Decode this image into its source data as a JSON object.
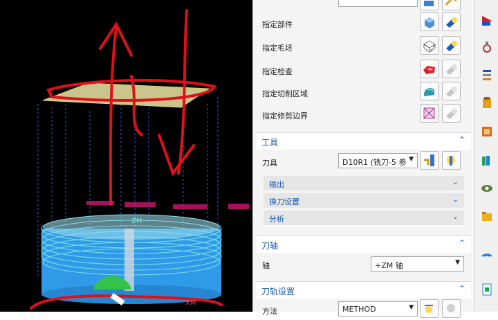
{
  "panel": {
    "geometry_rows": [
      {
        "label": "指定部件",
        "icon1": "part-select-icon",
        "icon2": "flashlight-icon"
      },
      {
        "label": "指定毛坯",
        "icon1": "blank-select-icon",
        "icon2": "flashlight-icon"
      },
      {
        "label": "指定检查",
        "icon1": "check-select-icon",
        "icon2": "flashlight-disabled-icon"
      },
      {
        "label": "指定切削区域",
        "icon1": "cut-area-select-icon",
        "icon2": "flashlight-disabled-icon"
      },
      {
        "label": "指定修剪边界",
        "icon1": "trim-boundary-select-icon",
        "icon2": "flashlight-disabled-icon"
      }
    ],
    "tool_section": {
      "title": "工具",
      "tool_label": "刀具",
      "tool_value": "D10R1 (铣刀-5 参",
      "subsections": [
        "输出",
        "换刀设置",
        "分析"
      ]
    },
    "axis_section": {
      "title": "刀轴",
      "axis_label": "轴",
      "axis_value": "+ZM 轴"
    },
    "path_section": {
      "title": "刀轨设置",
      "method_label": "方法",
      "method_value": "METHOD"
    }
  },
  "viewport": {
    "axis_label_zm": "ZM",
    "axis_label_xm": "XM"
  },
  "colors": {
    "accent": "#1d5aa8",
    "annotation_red": "#e0101a",
    "toolpath_cyan": "#7fe0e8",
    "stock_blue": "#2f9be8"
  }
}
